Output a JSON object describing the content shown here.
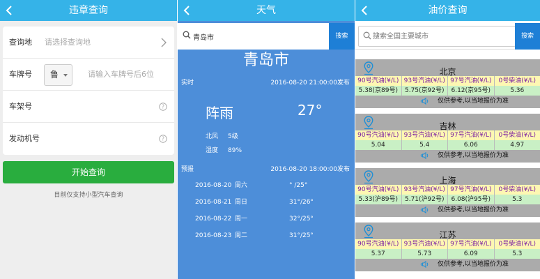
{
  "panel1": {
    "title": "违章查询",
    "rows": [
      {
        "label": "查询地",
        "placeholder": "请选择查询地"
      },
      {
        "label": "车牌号",
        "province": "鲁",
        "placeholder": "请输入车牌号后6位"
      },
      {
        "label": "车架号"
      },
      {
        "label": "发动机号"
      }
    ],
    "button": "开始查询",
    "note": "目前仅支持小型汽车查询"
  },
  "panel2": {
    "title": "天气",
    "search_value": "青岛市",
    "search_button": "搜索",
    "city": "青岛市",
    "realtime_label": "实时",
    "realtime_time": "2016-08-20 21:00:00发布",
    "condition": "阵雨",
    "temperature": "27°",
    "wind_label": "北风",
    "wind_value": "5级",
    "humidity_label": "湿度",
    "humidity_value": "89%",
    "forecast_label": "预报",
    "forecast_time": "2016-08-20 18:00:00发布",
    "forecast": [
      {
        "date": "2016-08-20",
        "weekday": "周六",
        "temp": "° /25°"
      },
      {
        "date": "2016-08-21",
        "weekday": "周日",
        "temp": "31°/26°"
      },
      {
        "date": "2016-08-22",
        "weekday": "周一",
        "temp": "32°/25°"
      },
      {
        "date": "2016-08-23",
        "weekday": "周二",
        "temp": "31°/25°"
      }
    ]
  },
  "panel3": {
    "title": "油价查询",
    "search_placeholder": "搜索全国主要城市",
    "search_button": "搜索",
    "headers": [
      "90号汽油(¥/L)",
      "93号汽油(¥/L)",
      "97号汽油(¥/L)",
      "0号柴油(¥/L)"
    ],
    "disclaimer": "仅供参考,以当地报价为准",
    "cities": [
      {
        "name": "北京",
        "prices": [
          "5.38(京89号)",
          "5.75(京92号)",
          "6.12(京95号)",
          "5.36"
        ]
      },
      {
        "name": "吉林",
        "prices": [
          "5.04",
          "5.4",
          "6.06",
          "4.97"
        ]
      },
      {
        "name": "上海",
        "prices": [
          "5.33(沪89号)",
          "5.71(沪92号)",
          "6.08(沪95号)",
          "5.3"
        ]
      },
      {
        "name": "江苏",
        "prices": [
          "5.37",
          "5.73",
          "6.09",
          "5.3"
        ]
      }
    ]
  },
  "colors": {
    "titlebar": "#35b3e8",
    "weather_bg": "#4d8ed9",
    "search_button": "#1e7fd6",
    "start_button": "#29ad3e",
    "card_bg": "#ababab",
    "header_cell": "#fdf7b2",
    "value_cell": "#c9f0c5",
    "header_text": "#7b1fa2"
  },
  "icons": [
    "back-arrow-icon",
    "chevron-right-icon",
    "help-icon",
    "search-icon",
    "location-pin-icon",
    "speaker-icon"
  ]
}
